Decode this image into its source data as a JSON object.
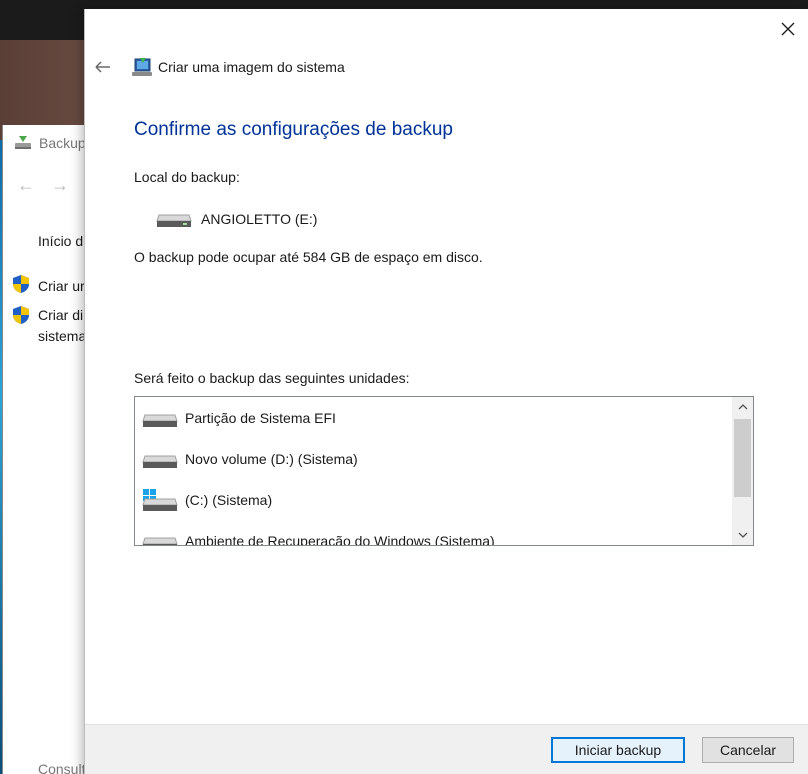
{
  "background_window": {
    "title": "Backup",
    "links": [
      "Início d",
      "Criar ur",
      "Criar di",
      "sistema"
    ],
    "footer": "Consult"
  },
  "dialog": {
    "header_title": "Criar uma imagem do sistema",
    "heading": "Confirme as configurações de backup",
    "location_label": "Local do backup:",
    "location_drive": "ANGIOLETTO (E:)",
    "size_text": "O backup pode ocupar até 584 GB de espaço em disco.",
    "drives_label": "Será feito o backup das seguintes unidades:",
    "drives": [
      {
        "name": "Partição de Sistema EFI",
        "icon": "drive-icon"
      },
      {
        "name": "Novo volume (D:) (Sistema)",
        "icon": "drive-icon"
      },
      {
        "name": "(C:) (Sistema)",
        "icon": "windows-drive-icon"
      },
      {
        "name": "Ambiente de Recuperação do Windows (Sistema)",
        "icon": "drive-icon"
      }
    ],
    "buttons": {
      "start": "Iniciar backup",
      "cancel": "Cancelar"
    }
  },
  "colors": {
    "heading": "#003399",
    "primary_border": "#0078d7",
    "footer_bg": "#f0f0f0"
  }
}
